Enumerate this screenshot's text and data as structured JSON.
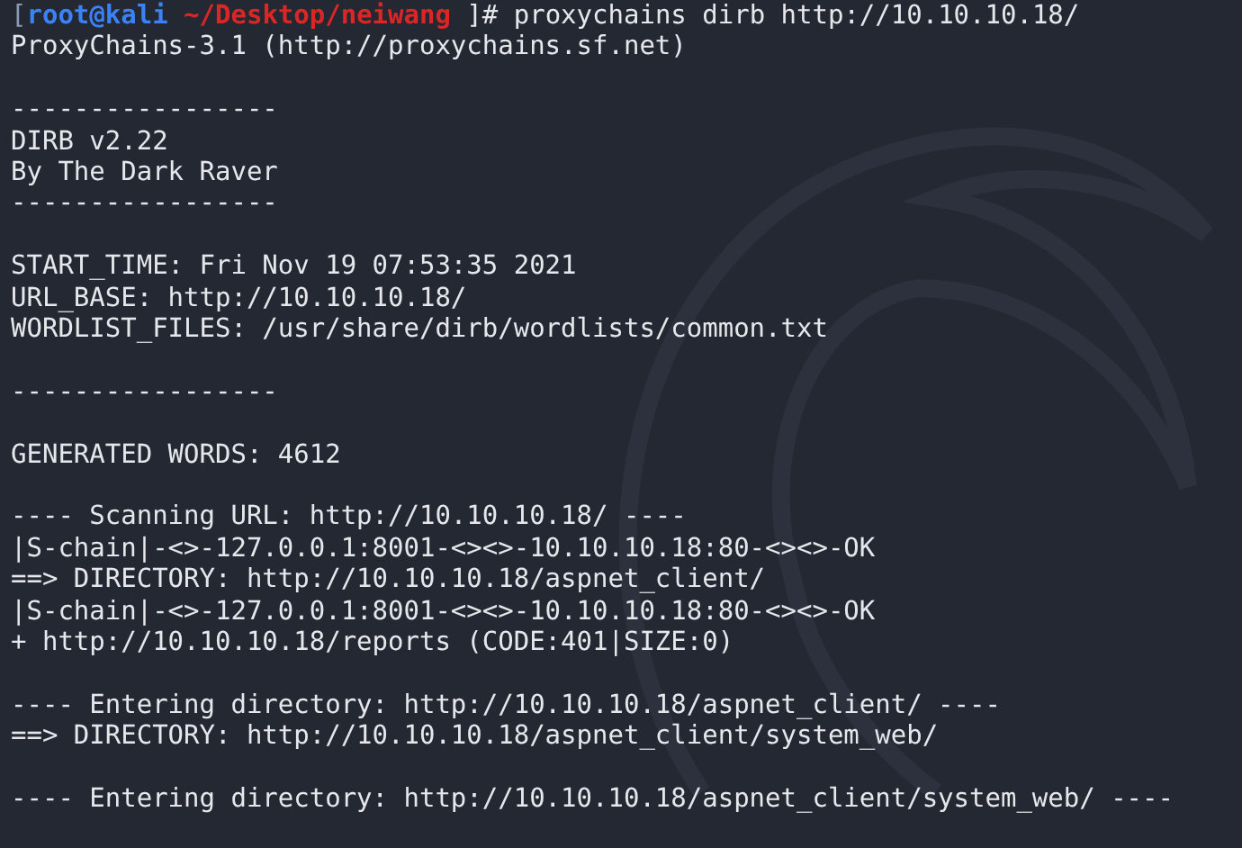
{
  "terminal": {
    "lines": [
      {
        "kind": "prompt",
        "segments": [
          {
            "text": "[",
            "color": "#8a9bb8"
          },
          {
            "text": "root@kali",
            "color": "#3b82f6"
          },
          {
            "text": " ~/Desktop/neiwang",
            "color": "#dc2626"
          },
          {
            "text": " ]# proxychains dirb http://10.10.10.18/",
            "color": "#e5e7eb"
          }
        ]
      },
      {
        "kind": "text",
        "text": "ProxyChains-3.1 (http://proxychains.sf.net)"
      },
      {
        "kind": "blank"
      },
      {
        "kind": "text",
        "text": "-----------------"
      },
      {
        "kind": "text",
        "text": "DIRB v2.22"
      },
      {
        "kind": "text",
        "text": "By The Dark Raver"
      },
      {
        "kind": "text",
        "text": "-----------------"
      },
      {
        "kind": "blank"
      },
      {
        "kind": "text",
        "text": "START_TIME: Fri Nov 19 07:53:35 2021"
      },
      {
        "kind": "text",
        "text": "URL_BASE: http://10.10.10.18/"
      },
      {
        "kind": "text",
        "text": "WORDLIST_FILES: /usr/share/dirb/wordlists/common.txt"
      },
      {
        "kind": "blank"
      },
      {
        "kind": "text",
        "text": "-----------------"
      },
      {
        "kind": "blank"
      },
      {
        "kind": "text",
        "text": "GENERATED WORDS: 4612"
      },
      {
        "kind": "blank"
      },
      {
        "kind": "text",
        "text": "---- Scanning URL: http://10.10.10.18/ ----"
      },
      {
        "kind": "text",
        "text": "|S-chain|-<>-127.0.0.1:8001-<><>-10.10.10.18:80-<><>-OK"
      },
      {
        "kind": "text",
        "text": "==> DIRECTORY: http://10.10.10.18/aspnet_client/"
      },
      {
        "kind": "text",
        "text": "|S-chain|-<>-127.0.0.1:8001-<><>-10.10.10.18:80-<><>-OK"
      },
      {
        "kind": "text",
        "text": "+ http://10.10.10.18/reports (CODE:401|SIZE:0)"
      },
      {
        "kind": "blank"
      },
      {
        "kind": "text",
        "text": "---- Entering directory: http://10.10.10.18/aspnet_client/ ----"
      },
      {
        "kind": "text",
        "text": "==> DIRECTORY: http://10.10.10.18/aspnet_client/system_web/"
      },
      {
        "kind": "blank"
      },
      {
        "kind": "text",
        "text": "---- Entering directory: http://10.10.10.18/aspnet_client/system_web/ ----"
      }
    ]
  }
}
